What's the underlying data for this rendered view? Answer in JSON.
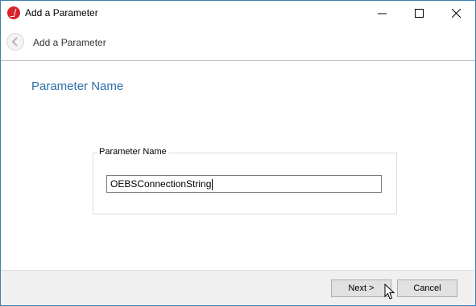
{
  "window": {
    "title": "Add a Parameter"
  },
  "header": {
    "title": "Add a Parameter"
  },
  "main": {
    "heading": "Parameter Name",
    "group_label": "Parameter Name",
    "parameter_value": "OEBSConnectionString"
  },
  "footer": {
    "next_label": "Next >",
    "cancel_label": "Cancel"
  },
  "colors": {
    "accent": "#2b6fa8",
    "app_icon": "#d8232a"
  },
  "icons": {
    "app": "app-logo-icon",
    "back": "back-arrow-icon",
    "minimize": "minimize-icon",
    "maximize": "maximize-icon",
    "close": "close-icon"
  }
}
